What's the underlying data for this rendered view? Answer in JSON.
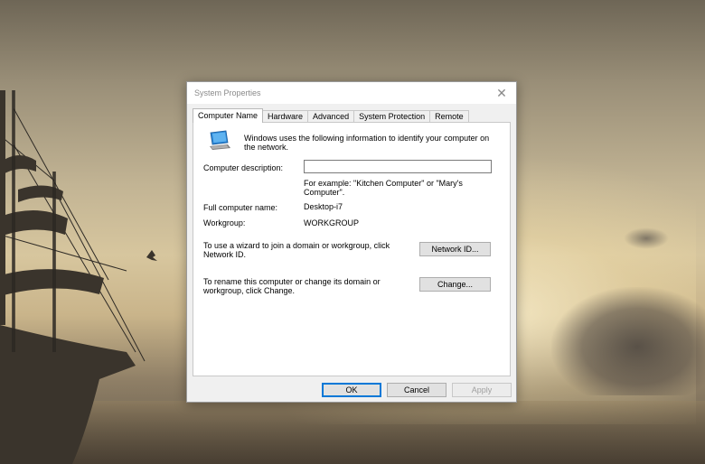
{
  "window": {
    "title": "System Properties",
    "close_glyph": "✕"
  },
  "tabs": [
    {
      "label": "Computer Name",
      "active": true
    },
    {
      "label": "Hardware",
      "active": false
    },
    {
      "label": "Advanced",
      "active": false
    },
    {
      "label": "System Protection",
      "active": false
    },
    {
      "label": "Remote",
      "active": false
    }
  ],
  "computer_name": {
    "intro": "Windows uses the following information to identify your computer on the network.",
    "description_label": "Computer description:",
    "description_value": "",
    "description_hint": "For example: \"Kitchen Computer\" or \"Mary's Computer\".",
    "full_name_label": "Full computer name:",
    "full_name_value": "Desktop-i7",
    "workgroup_label": "Workgroup:",
    "workgroup_value": "WORKGROUP",
    "network_text": "To use a wizard to join a domain or workgroup, click Network ID.",
    "network_button": "Network ID...",
    "change_text": "To rename this computer or change its domain or workgroup, click Change.",
    "change_button": "Change..."
  },
  "footer": {
    "ok": "OK",
    "cancel": "Cancel",
    "apply": "Apply"
  },
  "icons": {
    "computer": "computer-icon",
    "close": "close-icon"
  },
  "colors": {
    "accent": "#0078d7",
    "dialog_bg": "#f0f0f0"
  }
}
